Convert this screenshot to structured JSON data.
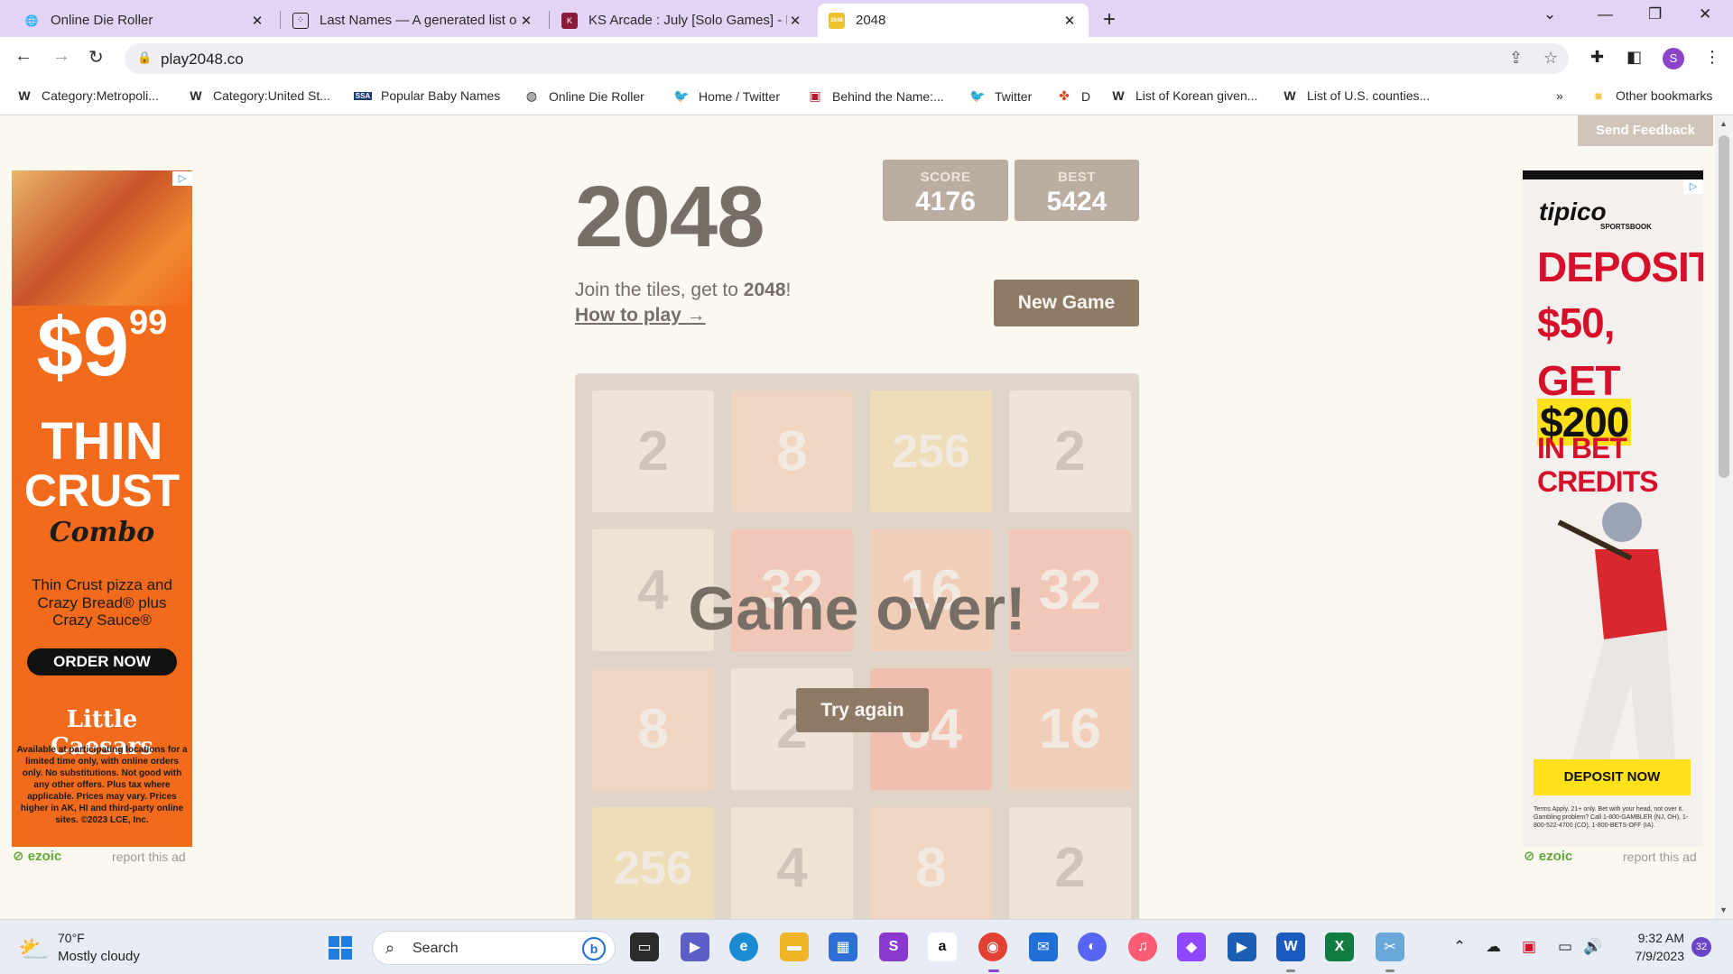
{
  "browser": {
    "tabs": [
      {
        "title": "Online Die Roller",
        "icon": "globe-icon"
      },
      {
        "title": "Last Names — A generated list o",
        "icon": "dice-icon"
      },
      {
        "title": "KS Arcade : July [Solo Games] - K",
        "icon": "ks-arcade-icon"
      },
      {
        "title": "2048",
        "icon": "2048-icon"
      }
    ],
    "active_tab": 3,
    "url": "play2048.co",
    "profile_initial": "S",
    "bookmarks": [
      {
        "label": "Category:Metropoli...",
        "icon": "W"
      },
      {
        "label": "Category:United St...",
        "icon": "W"
      },
      {
        "label": "Popular Baby Names",
        "icon": "SSA"
      },
      {
        "label": "Online Die Roller",
        "icon": "globe-icon"
      },
      {
        "label": "Home / Twitter",
        "icon": "twitter-icon"
      },
      {
        "label": "Behind the Name:...",
        "icon": "btn-icon"
      },
      {
        "label": "Twitter",
        "icon": "twitter-icon"
      },
      {
        "label": "D",
        "icon": "pinwheel-icon"
      },
      {
        "label": "List of Korean given...",
        "icon": "W"
      },
      {
        "label": "List of U.S. counties...",
        "icon": "W"
      }
    ],
    "more_bookmarks": "»",
    "other_bookmarks": "Other bookmarks"
  },
  "page": {
    "feedback_label": "Send Feedback",
    "title": "2048",
    "score_label": "SCORE",
    "score": "4176",
    "best_label": "BEST",
    "best": "5424",
    "intro_prefix": "Join the tiles, get to ",
    "intro_bold": "2048",
    "intro_suffix": "!",
    "how_to_play": "How to play →",
    "new_game_label": "New Game",
    "game_over": "Game over!",
    "try_again_label": "Try again",
    "board": [
      [
        "2",
        "8",
        "256",
        "2"
      ],
      [
        "4",
        "32",
        "16",
        "32"
      ],
      [
        "8",
        "2",
        "64",
        "16"
      ],
      [
        "256",
        "4",
        "8",
        "2"
      ]
    ],
    "tile_colors": {
      "2": "#eee4da",
      "4": "#ede0c8",
      "8": "#f2b179",
      "16": "#f59563",
      "32": "#f67c5f",
      "64": "#f65e3b",
      "256": "#edcc61"
    }
  },
  "ads": {
    "left": {
      "price_main": "$9",
      "price_cents": "99",
      "line1": "THIN",
      "line2": "CRUST",
      "line3": "Combo",
      "desc": "Thin Crust pizza and Crazy Bread® plus Crazy Sauce®",
      "cta": "ORDER NOW",
      "brand": "Little Caesars",
      "fine": "Available at participating locations for a limited time only, with online orders only. No substitutions. Not good with any other offers. Plus tax where applicable. Prices may vary. Prices higher in AK, HI and third-party online sites. ©2023 LCE, Inc."
    },
    "right": {
      "logo": "tipico",
      "logo_sub": "SPORTSBOOK",
      "line1": "DEPOSIT",
      "line2": "$50,",
      "line3_prefix": "GET",
      "line3_highlight": "$200",
      "line4": "IN BET CREDITS",
      "cta": "DEPOSIT NOW",
      "terms": "Terms Apply. 21+ only. Bet with your head, not over it. Gambling problem? Call 1-800-GAMBLER (NJ, OH), 1-800-522-4700 (CO), 1-800-BETS-OFF (IA)."
    },
    "ezoic": "ezoic",
    "report": "report this ad"
  },
  "taskbar": {
    "weather_temp": "70°F",
    "weather_desc": "Mostly cloudy",
    "search_placeholder": "Search",
    "time": "9:32 AM",
    "date": "7/9/2023",
    "notifications": "32"
  }
}
